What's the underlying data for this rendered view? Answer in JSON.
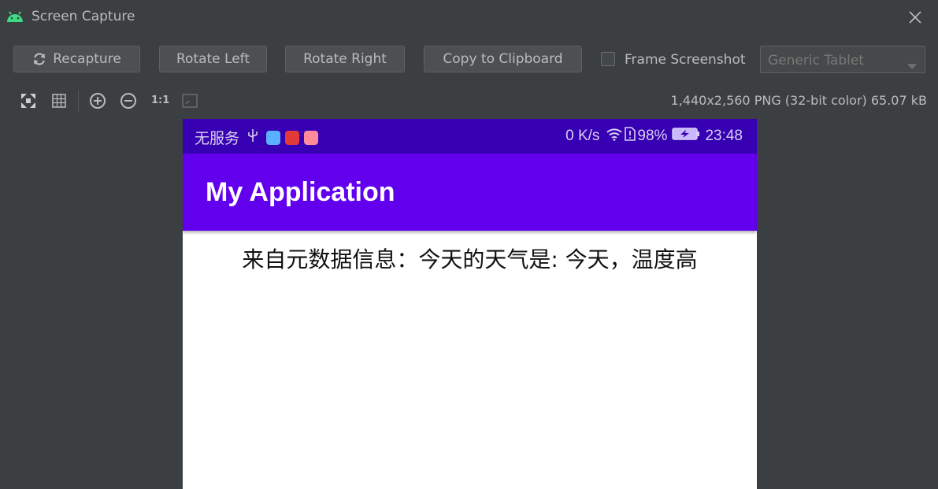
{
  "window": {
    "title": "Screen Capture",
    "app_icon": "android-icon",
    "close_icon": "close-icon"
  },
  "toolbar": {
    "recapture_label": "Recapture",
    "rotate_left_label": "Rotate Left",
    "rotate_right_label": "Rotate Right",
    "copy_label": "Copy to Clipboard",
    "frame_screenshot_label": "Frame Screenshot",
    "frame_screenshot_checked": false,
    "device_select": "Generic Tablet"
  },
  "iconbar": {
    "ratio_label": "1:1",
    "image_info": "1,440x2,560 PNG (32-bit color) 65.07 kB"
  },
  "device": {
    "statusbar": {
      "carrier": "无服务",
      "net_speed": "0 K/s",
      "battery": "98%",
      "time": "23:48"
    },
    "app_title": "My Application",
    "content_text": "来自元数据信息：今天的天气是:   今天，温度高"
  },
  "colors": {
    "ide_bg": "#3c3f41",
    "statusbar": "#3700b3",
    "appbar": "#6200ee"
  }
}
